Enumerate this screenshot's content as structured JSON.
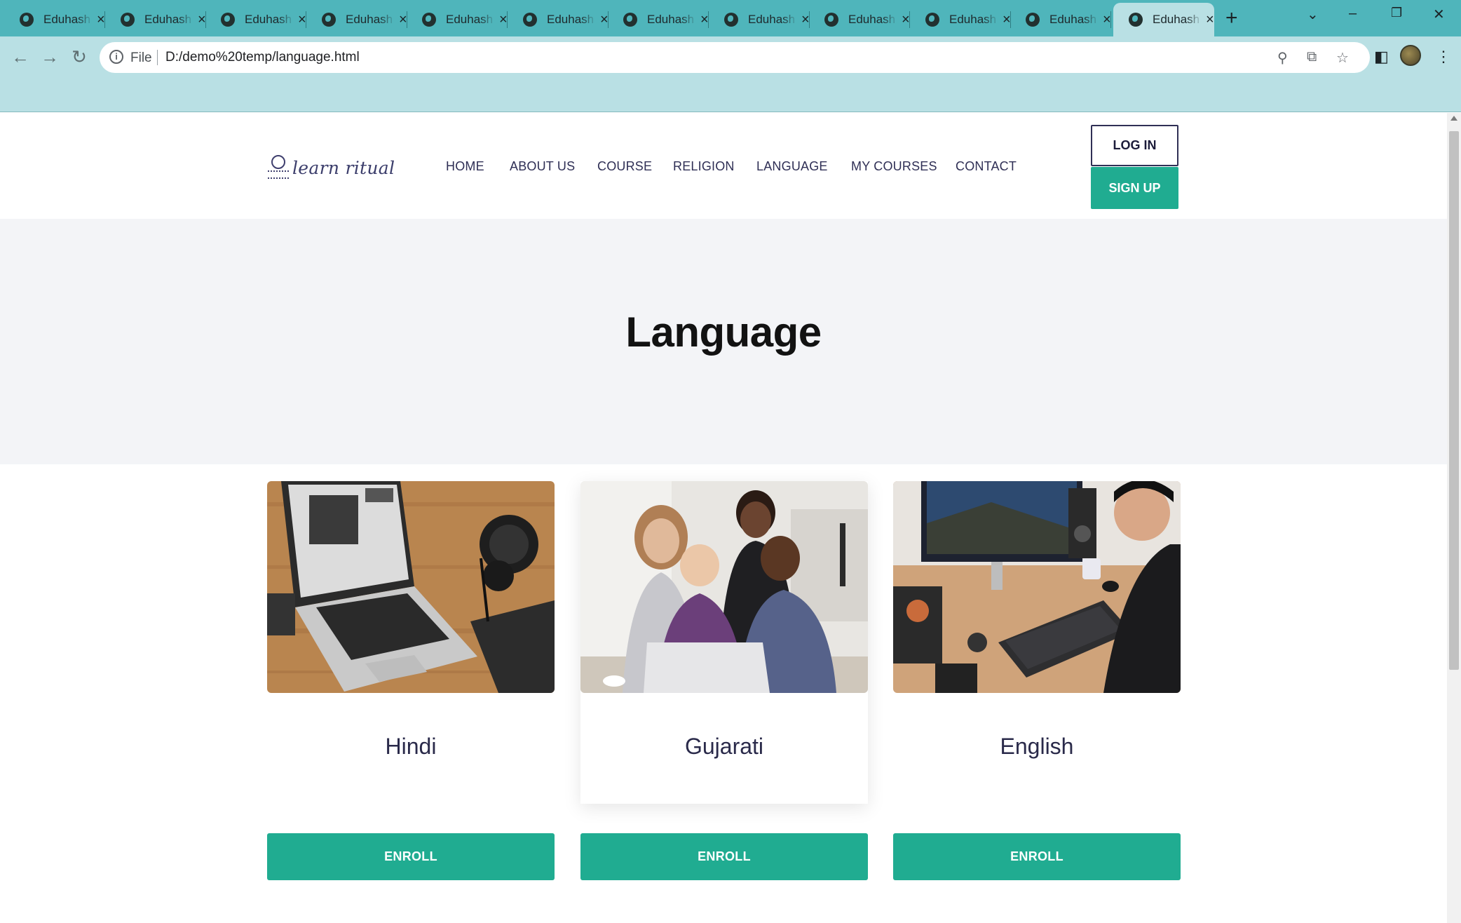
{
  "browser": {
    "tabs": [
      {
        "title": "Eduhash"
      },
      {
        "title": "Eduhash"
      },
      {
        "title": "Eduhash"
      },
      {
        "title": "Eduhash"
      },
      {
        "title": "Eduhash"
      },
      {
        "title": "Eduhash"
      },
      {
        "title": "Eduhash"
      },
      {
        "title": "Eduhash"
      },
      {
        "title": "Eduhash"
      },
      {
        "title": "Eduhash"
      },
      {
        "title": "Eduhash"
      },
      {
        "title": "Eduhash",
        "active": true
      }
    ],
    "new_tab_icon": "+",
    "address": {
      "scheme_label": "File",
      "url": "D:/demo%20temp/language.html"
    },
    "icons": [
      "back-icon",
      "forward-icon",
      "reload-icon",
      "info-icon",
      "zoom-icon",
      "share-icon",
      "bookmark-star-icon",
      "sidepanel-icon",
      "profile-avatar",
      "menu-icon",
      "tab-search-icon",
      "minimize-icon",
      "restore-icon",
      "close-window-icon"
    ]
  },
  "site": {
    "logo_text": "learn ritual",
    "nav": [
      "HOME",
      "ABOUT US",
      "COURSE",
      "RELIGION",
      "LANGUAGE",
      "MY COURSES",
      "CONTACT"
    ],
    "login_label": "LOG IN",
    "signup_label": "SIGN UP",
    "hero_title": "Language",
    "cards": [
      {
        "title": "Hindi",
        "image": "laptop-desk-photo",
        "button": "ENROLL"
      },
      {
        "title": "Gujarati",
        "image": "group-around-laptop-photo",
        "button": "ENROLL"
      },
      {
        "title": "English",
        "image": "desktop-workstation-photo",
        "button": "ENROLL"
      }
    ]
  },
  "colors": {
    "tabstrip": "#4fb5bb",
    "toolbar": "#b9e0e4",
    "accent": "#20ac91",
    "hero_bg": "#f3f4f7",
    "nav_text": "#2f2f55"
  }
}
